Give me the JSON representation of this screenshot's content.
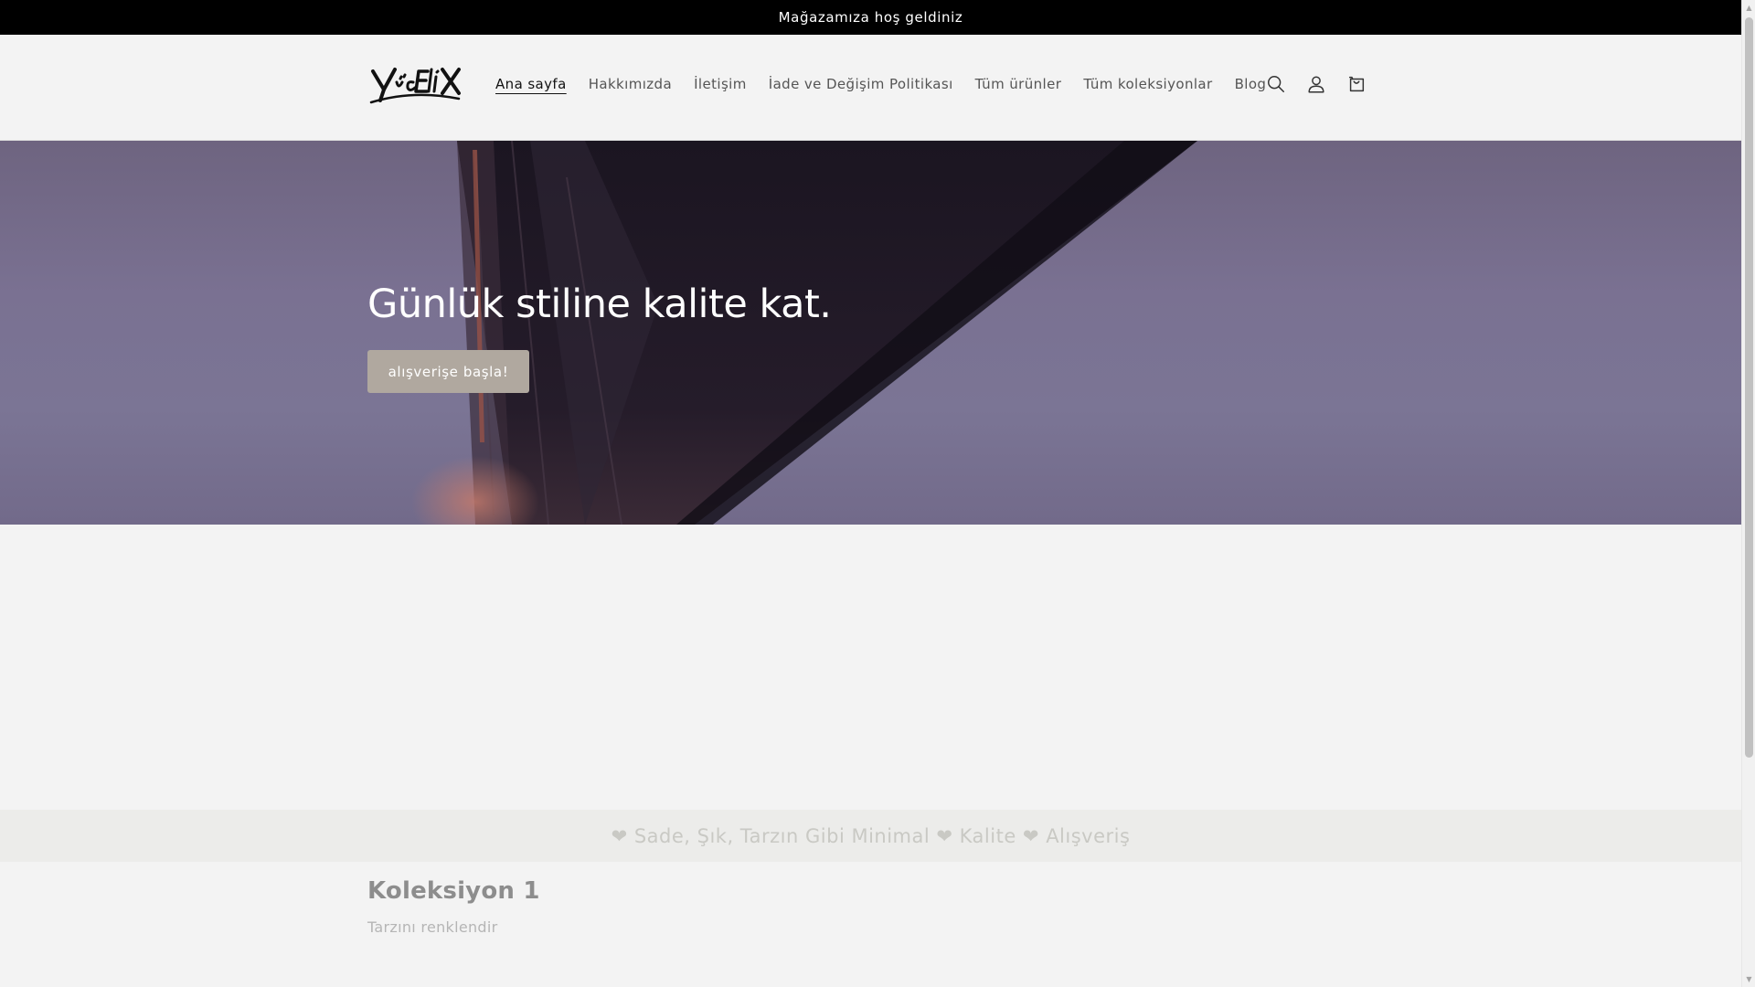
{
  "announcement": {
    "text": "Mağazamıza hoş geldiniz"
  },
  "header": {
    "logo_text": "YücEliX",
    "nav": [
      {
        "label": "Ana sayfa",
        "active": true
      },
      {
        "label": "Hakkımızda",
        "active": false
      },
      {
        "label": "İletişim",
        "active": false
      },
      {
        "label": "İade ve Değişim Politikası",
        "active": false
      },
      {
        "label": "Tüm ürünler",
        "active": false
      },
      {
        "label": "Tüm koleksiyonlar",
        "active": false
      },
      {
        "label": "Blog",
        "active": false
      }
    ],
    "icons": [
      "search-icon",
      "account-icon",
      "cart-icon"
    ]
  },
  "hero": {
    "title": "Günlük stiline kalite kat.",
    "button_label": "alışverişe başla!"
  },
  "marquee": {
    "text": "❤ Sade, Şık, Tarzın Gibi Minimal ❤ Kalite ❤ Alışveriş"
  },
  "collection": {
    "title": "Koleksiyon 1",
    "subtitle": "Tarzını renklendir"
  },
  "colors": {
    "announcement_bg": "#000000",
    "page_bg": "#f3f3f3",
    "hero_button_bg": "#b0a89f"
  }
}
